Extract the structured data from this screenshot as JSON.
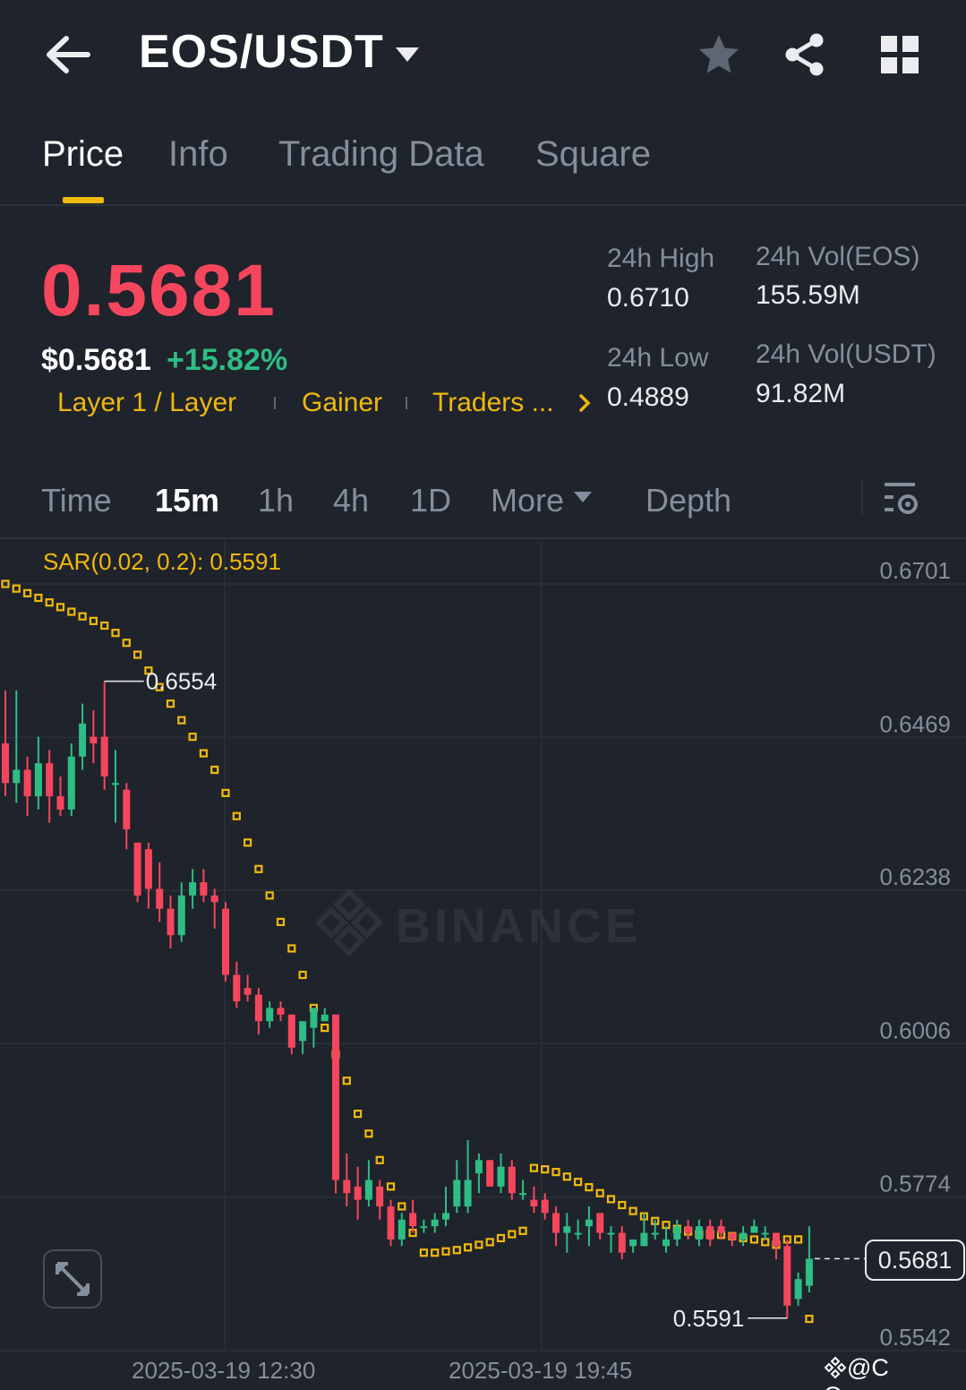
{
  "header": {
    "title": "EOS/USDT"
  },
  "tabs": [
    {
      "label": "Price",
      "active": true
    },
    {
      "label": "Info",
      "active": false
    },
    {
      "label": "Trading Data",
      "active": false
    },
    {
      "label": "Square",
      "active": false
    }
  ],
  "price": {
    "last": "0.5681",
    "usd": "$0.5681",
    "change": "+15.82%"
  },
  "tags": [
    "Layer 1 / Layer",
    "Gainer",
    "Traders ..."
  ],
  "stats": {
    "high_label": "24h High",
    "high_value": "0.6710",
    "low_label": "24h Low",
    "low_value": "0.4889",
    "vol_base_label": "24h Vol(EOS)",
    "vol_base_value": "155.59M",
    "vol_quote_label": "24h Vol(USDT)",
    "vol_quote_value": "91.82M"
  },
  "intervals": [
    {
      "label": "Time",
      "active": false
    },
    {
      "label": "15m",
      "active": true
    },
    {
      "label": "1h",
      "active": false
    },
    {
      "label": "4h",
      "active": false
    },
    {
      "label": "1D",
      "active": false
    },
    {
      "label": "More",
      "active": false
    },
    {
      "label": "Depth",
      "active": false
    }
  ],
  "chart": {
    "indicator_label": "SAR(0.02, 0.2): 0.5591",
    "watermark": "BINANCE",
    "y_ticks": [
      "0.6701",
      "0.6469",
      "0.6238",
      "0.6006",
      "0.5774",
      "0.5542"
    ],
    "x_ticks": [
      "2025-03-19 12:30",
      "2025-03-19 19:45"
    ],
    "high_marker": "0.6554",
    "low_marker": "0.5591",
    "current_price_tag": "0.5681",
    "credit": "@C Queen"
  },
  "colors": {
    "up": "#2ebd85",
    "down": "#f6465d",
    "accent": "#f0b90b",
    "background": "#1f232b"
  },
  "chart_data": {
    "type": "candlestick",
    "interval": "15m",
    "ylim": [
      0.5542,
      0.6701
    ],
    "candles": [
      {
        "o": 0.646,
        "h": 0.654,
        "l": 0.638,
        "c": 0.64
      },
      {
        "o": 0.64,
        "h": 0.654,
        "l": 0.637,
        "c": 0.642
      },
      {
        "o": 0.642,
        "h": 0.644,
        "l": 0.635,
        "c": 0.638
      },
      {
        "o": 0.638,
        "h": 0.647,
        "l": 0.636,
        "c": 0.643
      },
      {
        "o": 0.643,
        "h": 0.645,
        "l": 0.634,
        "c": 0.638
      },
      {
        "o": 0.638,
        "h": 0.641,
        "l": 0.635,
        "c": 0.636
      },
      {
        "o": 0.636,
        "h": 0.646,
        "l": 0.635,
        "c": 0.644
      },
      {
        "o": 0.644,
        "h": 0.652,
        "l": 0.642,
        "c": 0.649
      },
      {
        "o": 0.647,
        "h": 0.651,
        "l": 0.643,
        "c": 0.646
      },
      {
        "o": 0.647,
        "h": 0.6554,
        "l": 0.639,
        "c": 0.641
      },
      {
        "o": 0.64,
        "h": 0.645,
        "l": 0.634,
        "c": 0.64
      },
      {
        "o": 0.639,
        "h": 0.64,
        "l": 0.63,
        "c": 0.633
      },
      {
        "o": 0.631,
        "h": 0.631,
        "l": 0.622,
        "c": 0.623
      },
      {
        "o": 0.63,
        "h": 0.631,
        "l": 0.621,
        "c": 0.624
      },
      {
        "o": 0.624,
        "h": 0.628,
        "l": 0.619,
        "c": 0.621
      },
      {
        "o": 0.621,
        "h": 0.623,
        "l": 0.615,
        "c": 0.617
      },
      {
        "o": 0.617,
        "h": 0.625,
        "l": 0.616,
        "c": 0.623
      },
      {
        "o": 0.623,
        "h": 0.627,
        "l": 0.621,
        "c": 0.625
      },
      {
        "o": 0.625,
        "h": 0.627,
        "l": 0.622,
        "c": 0.623
      },
      {
        "o": 0.623,
        "h": 0.624,
        "l": 0.618,
        "c": 0.622
      },
      {
        "o": 0.621,
        "h": 0.622,
        "l": 0.61,
        "c": 0.611
      },
      {
        "o": 0.611,
        "h": 0.613,
        "l": 0.606,
        "c": 0.607
      },
      {
        "o": 0.609,
        "h": 0.611,
        "l": 0.607,
        "c": 0.608
      },
      {
        "o": 0.608,
        "h": 0.609,
        "l": 0.602,
        "c": 0.604
      },
      {
        "o": 0.604,
        "h": 0.607,
        "l": 0.603,
        "c": 0.606
      },
      {
        "o": 0.606,
        "h": 0.607,
        "l": 0.604,
        "c": 0.605
      },
      {
        "o": 0.605,
        "h": 0.605,
        "l": 0.599,
        "c": 0.6
      },
      {
        "o": 0.601,
        "h": 0.604,
        "l": 0.599,
        "c": 0.604
      },
      {
        "o": 0.603,
        "h": 0.606,
        "l": 0.6,
        "c": 0.606
      },
      {
        "o": 0.604,
        "h": 0.606,
        "l": 0.604,
        "c": 0.605
      },
      {
        "o": 0.605,
        "h": 0.605,
        "l": 0.578,
        "c": 0.58
      },
      {
        "o": 0.58,
        "h": 0.584,
        "l": 0.576,
        "c": 0.578
      },
      {
        "o": 0.579,
        "h": 0.582,
        "l": 0.574,
        "c": 0.577
      },
      {
        "o": 0.577,
        "h": 0.583,
        "l": 0.576,
        "c": 0.58
      },
      {
        "o": 0.579,
        "h": 0.58,
        "l": 0.574,
        "c": 0.576
      },
      {
        "o": 0.576,
        "h": 0.577,
        "l": 0.57,
        "c": 0.571
      },
      {
        "o": 0.571,
        "h": 0.575,
        "l": 0.57,
        "c": 0.574
      },
      {
        "o": 0.575,
        "h": 0.577,
        "l": 0.572,
        "c": 0.573
      },
      {
        "o": 0.573,
        "h": 0.574,
        "l": 0.572,
        "c": 0.573
      },
      {
        "o": 0.573,
        "h": 0.575,
        "l": 0.572,
        "c": 0.574
      },
      {
        "o": 0.574,
        "h": 0.579,
        "l": 0.573,
        "c": 0.575
      },
      {
        "o": 0.576,
        "h": 0.583,
        "l": 0.575,
        "c": 0.58
      },
      {
        "o": 0.576,
        "h": 0.586,
        "l": 0.575,
        "c": 0.58
      },
      {
        "o": 0.581,
        "h": 0.584,
        "l": 0.578,
        "c": 0.583
      },
      {
        "o": 0.583,
        "h": 0.583,
        "l": 0.579,
        "c": 0.579
      },
      {
        "o": 0.579,
        "h": 0.584,
        "l": 0.578,
        "c": 0.582
      },
      {
        "o": 0.582,
        "h": 0.583,
        "l": 0.577,
        "c": 0.578
      },
      {
        "o": 0.578,
        "h": 0.58,
        "l": 0.577,
        "c": 0.578
      },
      {
        "o": 0.577,
        "h": 0.579,
        "l": 0.575,
        "c": 0.576
      },
      {
        "o": 0.577,
        "h": 0.578,
        "l": 0.574,
        "c": 0.575
      },
      {
        "o": 0.575,
        "h": 0.576,
        "l": 0.57,
        "c": 0.572
      },
      {
        "o": 0.572,
        "h": 0.575,
        "l": 0.569,
        "c": 0.573
      },
      {
        "o": 0.572,
        "h": 0.574,
        "l": 0.571,
        "c": 0.572
      },
      {
        "o": 0.573,
        "h": 0.576,
        "l": 0.57,
        "c": 0.574
      },
      {
        "o": 0.575,
        "h": 0.575,
        "l": 0.571,
        "c": 0.572
      },
      {
        "o": 0.572,
        "h": 0.573,
        "l": 0.569,
        "c": 0.572
      },
      {
        "o": 0.572,
        "h": 0.573,
        "l": 0.568,
        "c": 0.569
      },
      {
        "o": 0.57,
        "h": 0.571,
        "l": 0.569,
        "c": 0.571
      },
      {
        "o": 0.57,
        "h": 0.575,
        "l": 0.57,
        "c": 0.572
      },
      {
        "o": 0.572,
        "h": 0.574,
        "l": 0.571,
        "c": 0.572
      },
      {
        "o": 0.57,
        "h": 0.573,
        "l": 0.569,
        "c": 0.571
      },
      {
        "o": 0.571,
        "h": 0.574,
        "l": 0.57,
        "c": 0.573
      },
      {
        "o": 0.573,
        "h": 0.574,
        "l": 0.571,
        "c": 0.572
      },
      {
        "o": 0.571,
        "h": 0.574,
        "l": 0.57,
        "c": 0.573
      },
      {
        "o": 0.573,
        "h": 0.574,
        "l": 0.57,
        "c": 0.571
      },
      {
        "o": 0.573,
        "h": 0.574,
        "l": 0.571,
        "c": 0.572
      },
      {
        "o": 0.572,
        "h": 0.572,
        "l": 0.57,
        "c": 0.571
      },
      {
        "o": 0.571,
        "h": 0.573,
        "l": 0.57,
        "c": 0.572
      },
      {
        "o": 0.572,
        "h": 0.574,
        "l": 0.572,
        "c": 0.573
      },
      {
        "o": 0.572,
        "h": 0.573,
        "l": 0.571,
        "c": 0.572
      },
      {
        "o": 0.572,
        "h": 0.572,
        "l": 0.568,
        "c": 0.57
      },
      {
        "o": 0.57,
        "h": 0.571,
        "l": 0.5591,
        "c": 0.561
      },
      {
        "o": 0.562,
        "h": 0.566,
        "l": 0.561,
        "c": 0.565
      },
      {
        "o": 0.564,
        "h": 0.573,
        "l": 0.563,
        "c": 0.5681
      }
    ],
    "sar": [
      0.6701,
      0.6694,
      0.6687,
      0.668,
      0.6673,
      0.6666,
      0.6659,
      0.6652,
      0.6645,
      0.6638,
      0.6627,
      0.6612,
      0.6594,
      0.657,
      0.6545,
      0.652,
      0.6495,
      0.647,
      0.6445,
      0.642,
      0.6385,
      0.635,
      0.631,
      0.627,
      0.623,
      0.619,
      0.615,
      0.611,
      0.606,
      0.603,
      0.599,
      0.595,
      0.59,
      0.587,
      0.583,
      0.579,
      0.576,
      0.572,
      0.569,
      0.569,
      0.5692,
      0.5694,
      0.5698,
      0.5702,
      0.5706,
      0.5712,
      0.5718,
      0.5723,
      0.5818,
      0.5816,
      0.5812,
      0.5805,
      0.5797,
      0.5789,
      0.578,
      0.5771,
      0.5762,
      0.5753,
      0.5745,
      0.5738,
      0.5732,
      0.5726,
      0.5722,
      0.5718,
      0.5718,
      0.5717,
      0.5715,
      0.5712,
      0.571,
      0.5706,
      0.5702,
      0.571,
      0.571,
      0.559
    ],
    "ylabel": "",
    "xlabel": ""
  }
}
